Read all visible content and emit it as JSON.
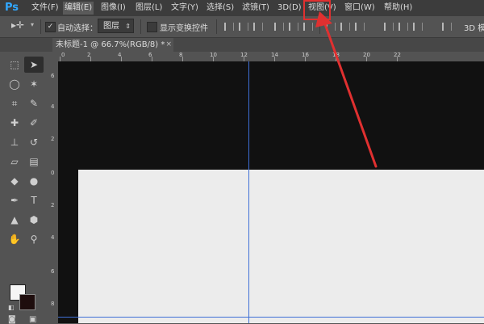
{
  "app": {
    "logo": "Ps"
  },
  "menu": [
    {
      "label": "文件(F)"
    },
    {
      "label": "编辑(E)"
    },
    {
      "label": "图像(I)"
    },
    {
      "label": "图层(L)"
    },
    {
      "label": "文字(Y)"
    },
    {
      "label": "选择(S)"
    },
    {
      "label": "滤镜(T)"
    },
    {
      "label": "3D(D)"
    },
    {
      "label": "视图(V)"
    },
    {
      "label": "窗口(W)"
    },
    {
      "label": "帮助(H)"
    }
  ],
  "options_bar": {
    "auto_select_label": "自动选择：",
    "auto_select_checked": "✓",
    "layer_select_value": "图层",
    "show_transform_label": "显示变换控件",
    "mode_3d_label": "3D 模"
  },
  "document_tab": {
    "title": "未标题-1 @ 66.7%(RGB/8) *",
    "close": "×"
  },
  "ruler_top_labels": [
    "0",
    "2",
    "4",
    "6",
    "8",
    "10",
    "12",
    "14",
    "16",
    "18",
    "20",
    "22"
  ],
  "ruler_left_labels": [
    "6",
    "4",
    "2",
    "0",
    "2",
    "4",
    "6",
    "8"
  ],
  "colors": {
    "foreground": "#f5f5f5",
    "background": "#1e0d0d",
    "guide": "#3f6fd6",
    "annotation": "#e03030",
    "accent": "#31a8ff"
  }
}
